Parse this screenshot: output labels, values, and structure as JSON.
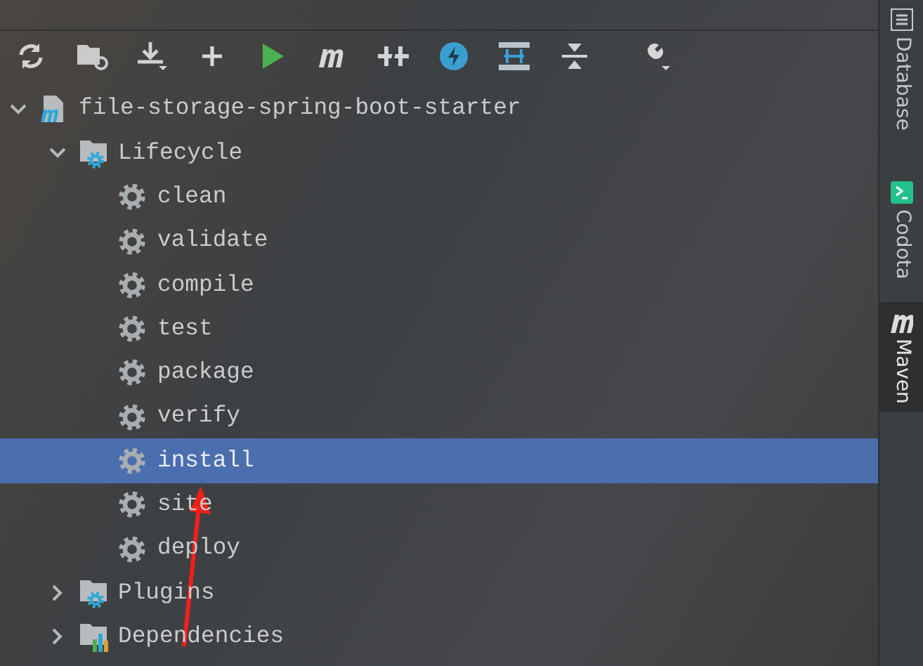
{
  "tree": [
    {
      "label": "file-storage-spring-boot-starter",
      "kind": "project",
      "expanded": true,
      "selected": false,
      "children": [
        {
          "label": "Lifecycle",
          "kind": "lifecycle",
          "expanded": true,
          "selected": false,
          "children": [
            {
              "label": "clean",
              "kind": "goal",
              "selected": false
            },
            {
              "label": "validate",
              "kind": "goal",
              "selected": false
            },
            {
              "label": "compile",
              "kind": "goal",
              "selected": false
            },
            {
              "label": "test",
              "kind": "goal",
              "selected": false
            },
            {
              "label": "package",
              "kind": "goal",
              "selected": false
            },
            {
              "label": "verify",
              "kind": "goal",
              "selected": false
            },
            {
              "label": "install",
              "kind": "goal",
              "selected": true
            },
            {
              "label": "site",
              "kind": "goal",
              "selected": false
            },
            {
              "label": "deploy",
              "kind": "goal",
              "selected": false
            }
          ]
        },
        {
          "label": "Plugins",
          "kind": "plugins",
          "expanded": false,
          "selected": false
        },
        {
          "label": "Dependencies",
          "kind": "dependencies",
          "expanded": false,
          "selected": false
        }
      ]
    }
  ],
  "side_tabs": [
    {
      "label": "Database",
      "selected": false
    },
    {
      "label": "Codota",
      "selected": false
    },
    {
      "label": "Maven",
      "selected": true
    }
  ]
}
